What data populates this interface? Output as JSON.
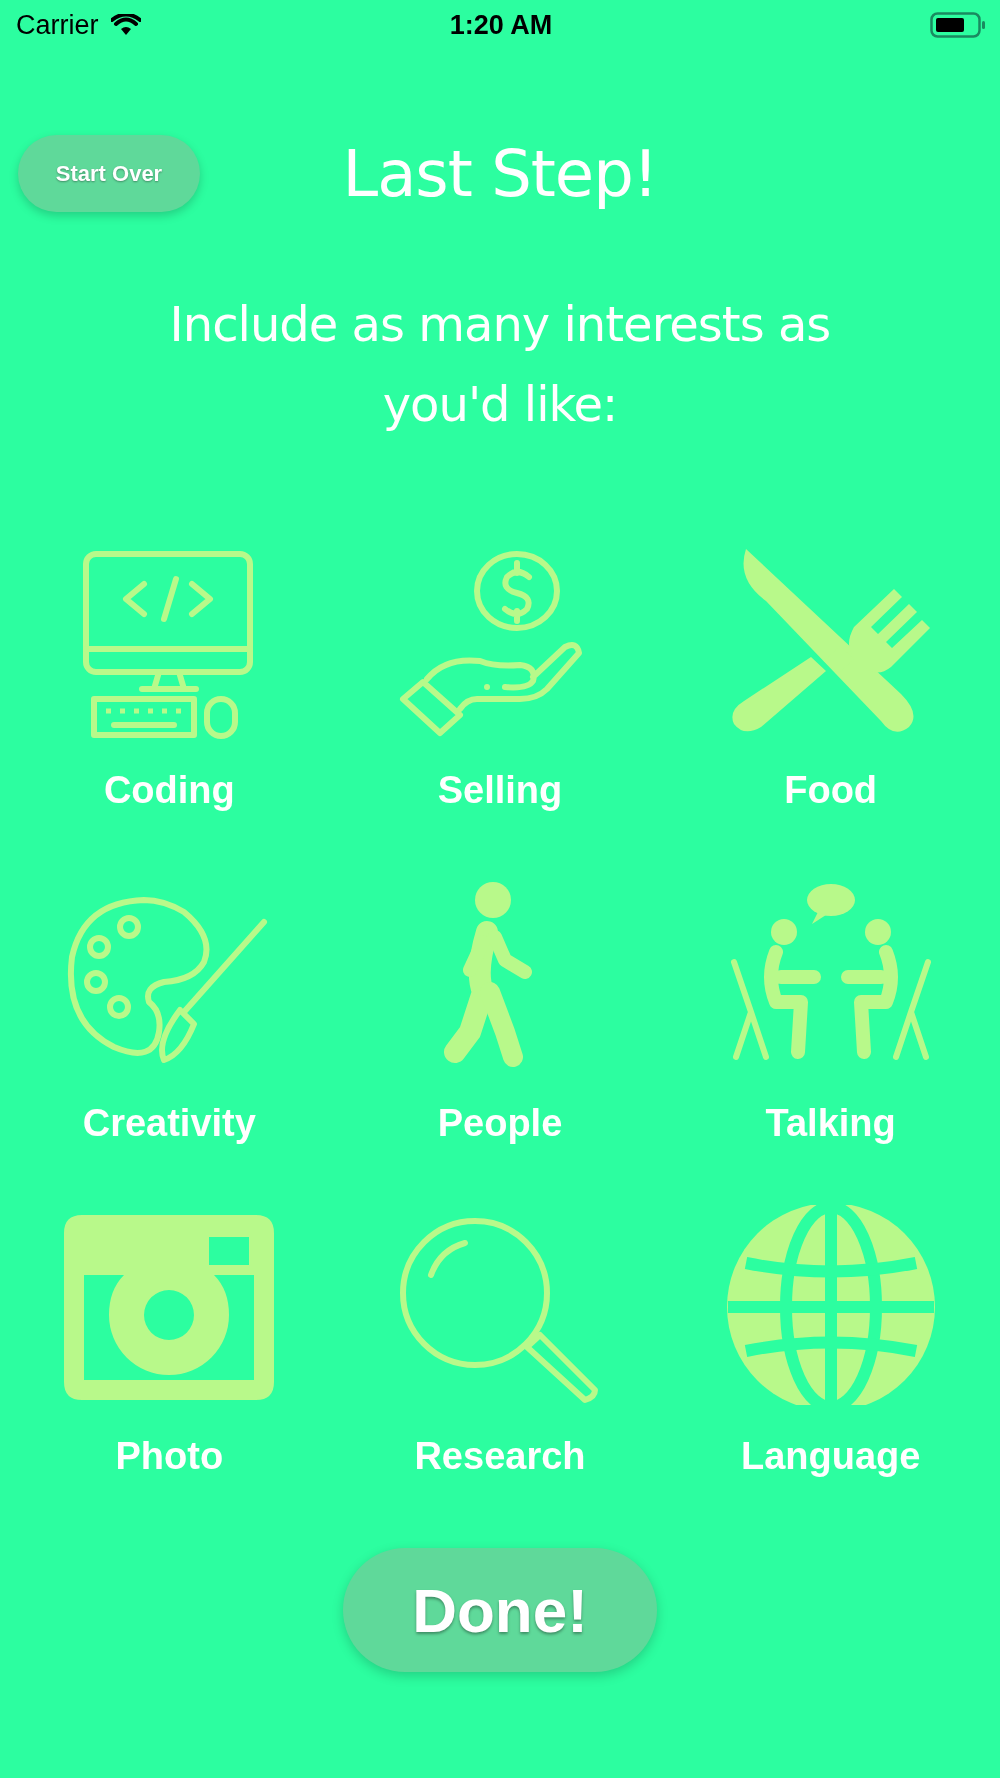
{
  "status_bar": {
    "carrier": "Carrier",
    "time": "1:20 AM"
  },
  "header": {
    "start_over": "Start Over",
    "title": "Last Step!",
    "subtitle": "Include as many interests as you'd like:"
  },
  "interests": [
    {
      "label": "Coding",
      "kind": "monitor"
    },
    {
      "label": "Selling",
      "kind": "hand-coin"
    },
    {
      "label": "Food",
      "kind": "utensils"
    },
    {
      "label": "Creativity",
      "kind": "palette"
    },
    {
      "label": "People",
      "kind": "walker"
    },
    {
      "label": "Talking",
      "kind": "conversation"
    },
    {
      "label": "Photo",
      "kind": "camera"
    },
    {
      "label": "Research",
      "kind": "magnifier"
    },
    {
      "label": "Language",
      "kind": "globe"
    }
  ],
  "done_button": "Done!"
}
